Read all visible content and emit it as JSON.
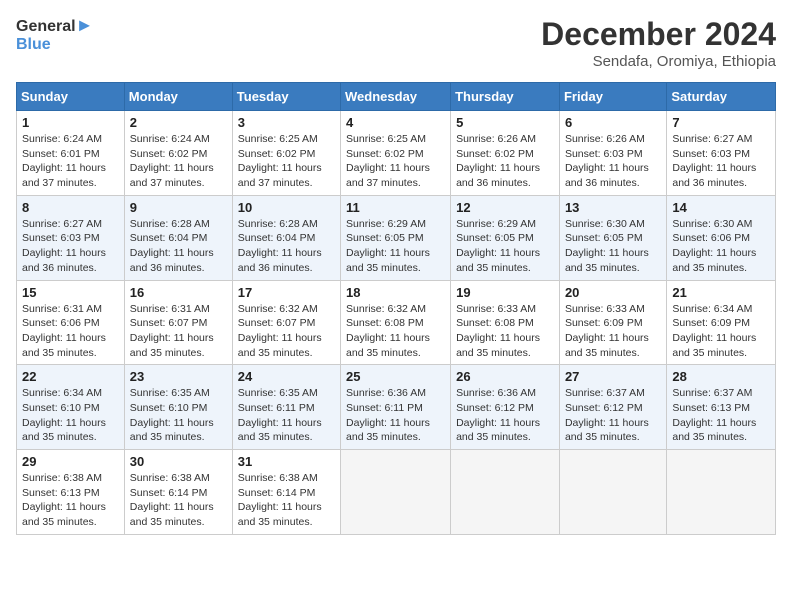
{
  "logo": {
    "line1": "General",
    "line2": "Blue"
  },
  "title": "December 2024",
  "location": "Sendafa, Oromiya, Ethiopia",
  "days_of_week": [
    "Sunday",
    "Monday",
    "Tuesday",
    "Wednesday",
    "Thursday",
    "Friday",
    "Saturday"
  ],
  "weeks": [
    [
      {
        "day": "1",
        "sunrise": "6:24 AM",
        "sunset": "6:01 PM",
        "daylight": "11 hours and 37 minutes."
      },
      {
        "day": "2",
        "sunrise": "6:24 AM",
        "sunset": "6:02 PM",
        "daylight": "11 hours and 37 minutes."
      },
      {
        "day": "3",
        "sunrise": "6:25 AM",
        "sunset": "6:02 PM",
        "daylight": "11 hours and 37 minutes."
      },
      {
        "day": "4",
        "sunrise": "6:25 AM",
        "sunset": "6:02 PM",
        "daylight": "11 hours and 37 minutes."
      },
      {
        "day": "5",
        "sunrise": "6:26 AM",
        "sunset": "6:02 PM",
        "daylight": "11 hours and 36 minutes."
      },
      {
        "day": "6",
        "sunrise": "6:26 AM",
        "sunset": "6:03 PM",
        "daylight": "11 hours and 36 minutes."
      },
      {
        "day": "7",
        "sunrise": "6:27 AM",
        "sunset": "6:03 PM",
        "daylight": "11 hours and 36 minutes."
      }
    ],
    [
      {
        "day": "8",
        "sunrise": "6:27 AM",
        "sunset": "6:03 PM",
        "daylight": "11 hours and 36 minutes."
      },
      {
        "day": "9",
        "sunrise": "6:28 AM",
        "sunset": "6:04 PM",
        "daylight": "11 hours and 36 minutes."
      },
      {
        "day": "10",
        "sunrise": "6:28 AM",
        "sunset": "6:04 PM",
        "daylight": "11 hours and 36 minutes."
      },
      {
        "day": "11",
        "sunrise": "6:29 AM",
        "sunset": "6:05 PM",
        "daylight": "11 hours and 35 minutes."
      },
      {
        "day": "12",
        "sunrise": "6:29 AM",
        "sunset": "6:05 PM",
        "daylight": "11 hours and 35 minutes."
      },
      {
        "day": "13",
        "sunrise": "6:30 AM",
        "sunset": "6:05 PM",
        "daylight": "11 hours and 35 minutes."
      },
      {
        "day": "14",
        "sunrise": "6:30 AM",
        "sunset": "6:06 PM",
        "daylight": "11 hours and 35 minutes."
      }
    ],
    [
      {
        "day": "15",
        "sunrise": "6:31 AM",
        "sunset": "6:06 PM",
        "daylight": "11 hours and 35 minutes."
      },
      {
        "day": "16",
        "sunrise": "6:31 AM",
        "sunset": "6:07 PM",
        "daylight": "11 hours and 35 minutes."
      },
      {
        "day": "17",
        "sunrise": "6:32 AM",
        "sunset": "6:07 PM",
        "daylight": "11 hours and 35 minutes."
      },
      {
        "day": "18",
        "sunrise": "6:32 AM",
        "sunset": "6:08 PM",
        "daylight": "11 hours and 35 minutes."
      },
      {
        "day": "19",
        "sunrise": "6:33 AM",
        "sunset": "6:08 PM",
        "daylight": "11 hours and 35 minutes."
      },
      {
        "day": "20",
        "sunrise": "6:33 AM",
        "sunset": "6:09 PM",
        "daylight": "11 hours and 35 minutes."
      },
      {
        "day": "21",
        "sunrise": "6:34 AM",
        "sunset": "6:09 PM",
        "daylight": "11 hours and 35 minutes."
      }
    ],
    [
      {
        "day": "22",
        "sunrise": "6:34 AM",
        "sunset": "6:10 PM",
        "daylight": "11 hours and 35 minutes."
      },
      {
        "day": "23",
        "sunrise": "6:35 AM",
        "sunset": "6:10 PM",
        "daylight": "11 hours and 35 minutes."
      },
      {
        "day": "24",
        "sunrise": "6:35 AM",
        "sunset": "6:11 PM",
        "daylight": "11 hours and 35 minutes."
      },
      {
        "day": "25",
        "sunrise": "6:36 AM",
        "sunset": "6:11 PM",
        "daylight": "11 hours and 35 minutes."
      },
      {
        "day": "26",
        "sunrise": "6:36 AM",
        "sunset": "6:12 PM",
        "daylight": "11 hours and 35 minutes."
      },
      {
        "day": "27",
        "sunrise": "6:37 AM",
        "sunset": "6:12 PM",
        "daylight": "11 hours and 35 minutes."
      },
      {
        "day": "28",
        "sunrise": "6:37 AM",
        "sunset": "6:13 PM",
        "daylight": "11 hours and 35 minutes."
      }
    ],
    [
      {
        "day": "29",
        "sunrise": "6:38 AM",
        "sunset": "6:13 PM",
        "daylight": "11 hours and 35 minutes."
      },
      {
        "day": "30",
        "sunrise": "6:38 AM",
        "sunset": "6:14 PM",
        "daylight": "11 hours and 35 minutes."
      },
      {
        "day": "31",
        "sunrise": "6:38 AM",
        "sunset": "6:14 PM",
        "daylight": "11 hours and 35 minutes."
      },
      null,
      null,
      null,
      null
    ]
  ],
  "colors": {
    "header_bg": "#3a7bbf",
    "header_text": "#ffffff",
    "row_even": "#eef4fb",
    "row_odd": "#ffffff"
  }
}
